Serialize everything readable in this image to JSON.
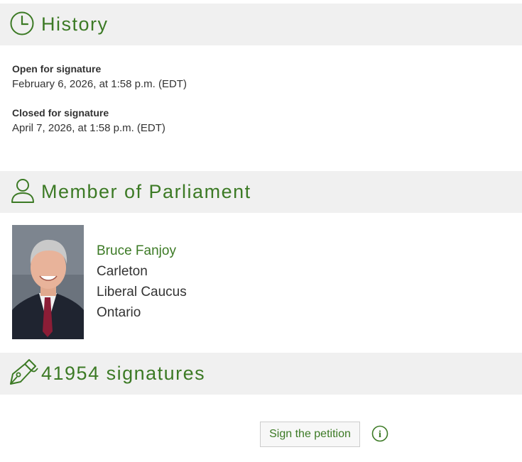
{
  "history": {
    "title": "History",
    "icon": "clock-icon",
    "open_label": "Open for signature",
    "open_date": "February 6, 2026, at 1:58 p.m. (EDT)",
    "closed_label": "Closed for signature",
    "closed_date": "April 7, 2026, at 1:58 p.m. (EDT)"
  },
  "member": {
    "title": "Member of Parliament",
    "icon": "person-icon",
    "name": "Bruce Fanjoy",
    "riding": "Carleton",
    "caucus": "Liberal Caucus",
    "province": "Ontario"
  },
  "signatures": {
    "title": "41954 signatures",
    "icon": "pen-icon",
    "sign_button": "Sign the petition",
    "info_icon": "info-icon"
  },
  "colors": {
    "accent": "#3c7a25",
    "header_bg": "#f0f0f0",
    "text": "#333333"
  }
}
